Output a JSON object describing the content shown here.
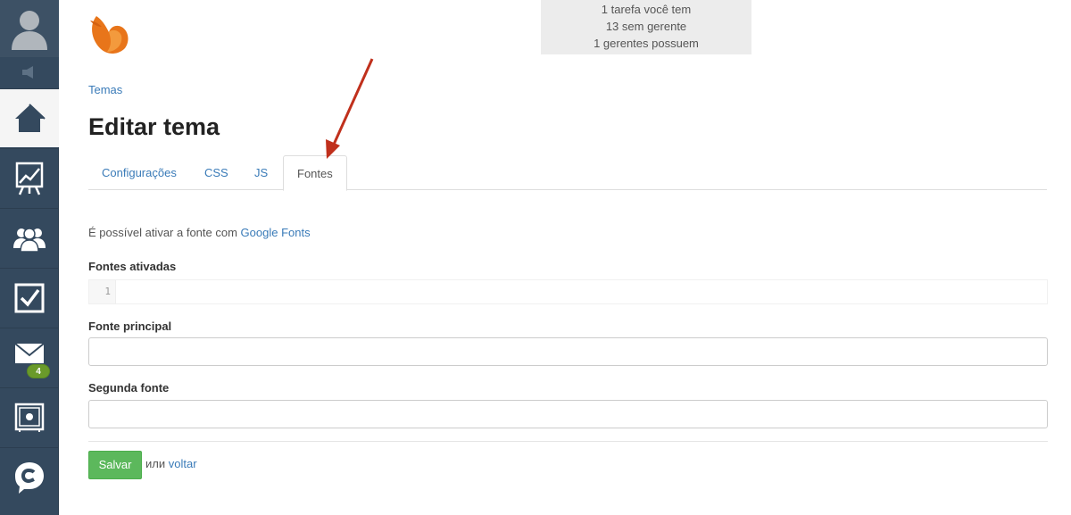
{
  "notice": {
    "line1": "1 tarefa você tem",
    "line2": "13 sem gerente",
    "line3": "1 gerentes possuem"
  },
  "sidebar": {
    "items": [
      {
        "name": "home",
        "icon": "home-icon",
        "active": true
      },
      {
        "name": "stats",
        "icon": "chart-icon"
      },
      {
        "name": "users",
        "icon": "users-icon"
      },
      {
        "name": "tasks",
        "icon": "checkbox-icon"
      },
      {
        "name": "mail",
        "icon": "mail-icon",
        "badge": "4"
      },
      {
        "name": "safe",
        "icon": "safe-icon"
      },
      {
        "name": "chat",
        "icon": "chat-icon"
      }
    ]
  },
  "breadcrumb": "Temas",
  "page_title": "Editar tema",
  "tabs": [
    "Configurações",
    "CSS",
    "JS",
    "Fontes"
  ],
  "active_tab": "Fontes",
  "intro": {
    "text": "É possível ativar a fonte com ",
    "link": "Google Fonts"
  },
  "fields": {
    "enabled_fonts_label": "Fontes ativadas",
    "enabled_fonts_line": "1",
    "main_font_label": "Fonte principal",
    "main_font_value": "",
    "second_font_label": "Segunda fonte",
    "second_font_value": ""
  },
  "actions": {
    "save_label": "Salvar",
    "or_text": "или",
    "back_link": "voltar"
  },
  "colors": {
    "sidebar": "#34495e",
    "link": "#3a7bb8",
    "save_button": "#5cb85c",
    "badge": "#6a9a2a",
    "arrow": "#c0301c"
  }
}
